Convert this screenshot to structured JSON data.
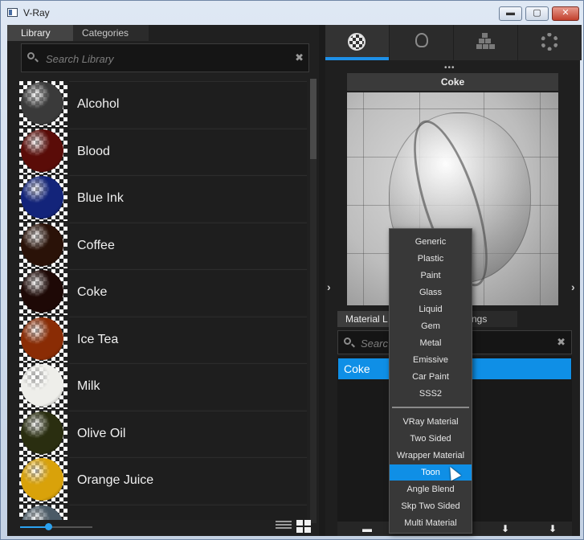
{
  "window": {
    "title": "V-Ray",
    "min_label": "▬",
    "max_label": "▢",
    "close_label": "✕"
  },
  "library": {
    "tabs": [
      "Library",
      "Categories"
    ],
    "search_placeholder": "Search Library",
    "clear_label": "✖",
    "items": [
      {
        "label": "Alcohol",
        "color": "#3a3a3a"
      },
      {
        "label": "Blood",
        "color": "#5a0c08"
      },
      {
        "label": "Blue Ink",
        "color": "#13247a"
      },
      {
        "label": "Coffee",
        "color": "#2a1208"
      },
      {
        "label": "Coke",
        "color": "#1e0906"
      },
      {
        "label": "Ice Tea",
        "color": "#8a2c05"
      },
      {
        "label": "Milk",
        "color": "#eeeeea"
      },
      {
        "label": "Olive Oil",
        "color": "#2a2e10"
      },
      {
        "label": "Orange Juice",
        "color": "#d9a20a"
      },
      {
        "label": "",
        "color": "#4a5a66"
      }
    ]
  },
  "right_panel": {
    "tab_icons": [
      "material-sphere-icon",
      "light-bulb-icon",
      "geometry-stack-icon",
      "settings-gear-icon"
    ],
    "dots": "•••",
    "preview_title": "Coke",
    "tabs": [
      "Material L",
      "ngs"
    ],
    "search_placeholder": "Searc",
    "clear_label": "✖",
    "selected_material": "Coke",
    "bottom_icons": [
      "remove-icon",
      "import-icon",
      "export-icon"
    ],
    "remove_label": "▬",
    "import_label": "⬇",
    "export_label": "⬇"
  },
  "context_menu": {
    "group1": [
      "Generic",
      "Plastic",
      "Paint",
      "Glass",
      "Liquid",
      "Gem",
      "Metal",
      "Emissive",
      "Car Paint",
      "SSS2"
    ],
    "group2": [
      "VRay Material",
      "Two Sided",
      "Wrapper Material",
      "Toon",
      "Angle Blend",
      "Skp Two Sided",
      "Multi Material"
    ],
    "highlighted": "Toon"
  }
}
